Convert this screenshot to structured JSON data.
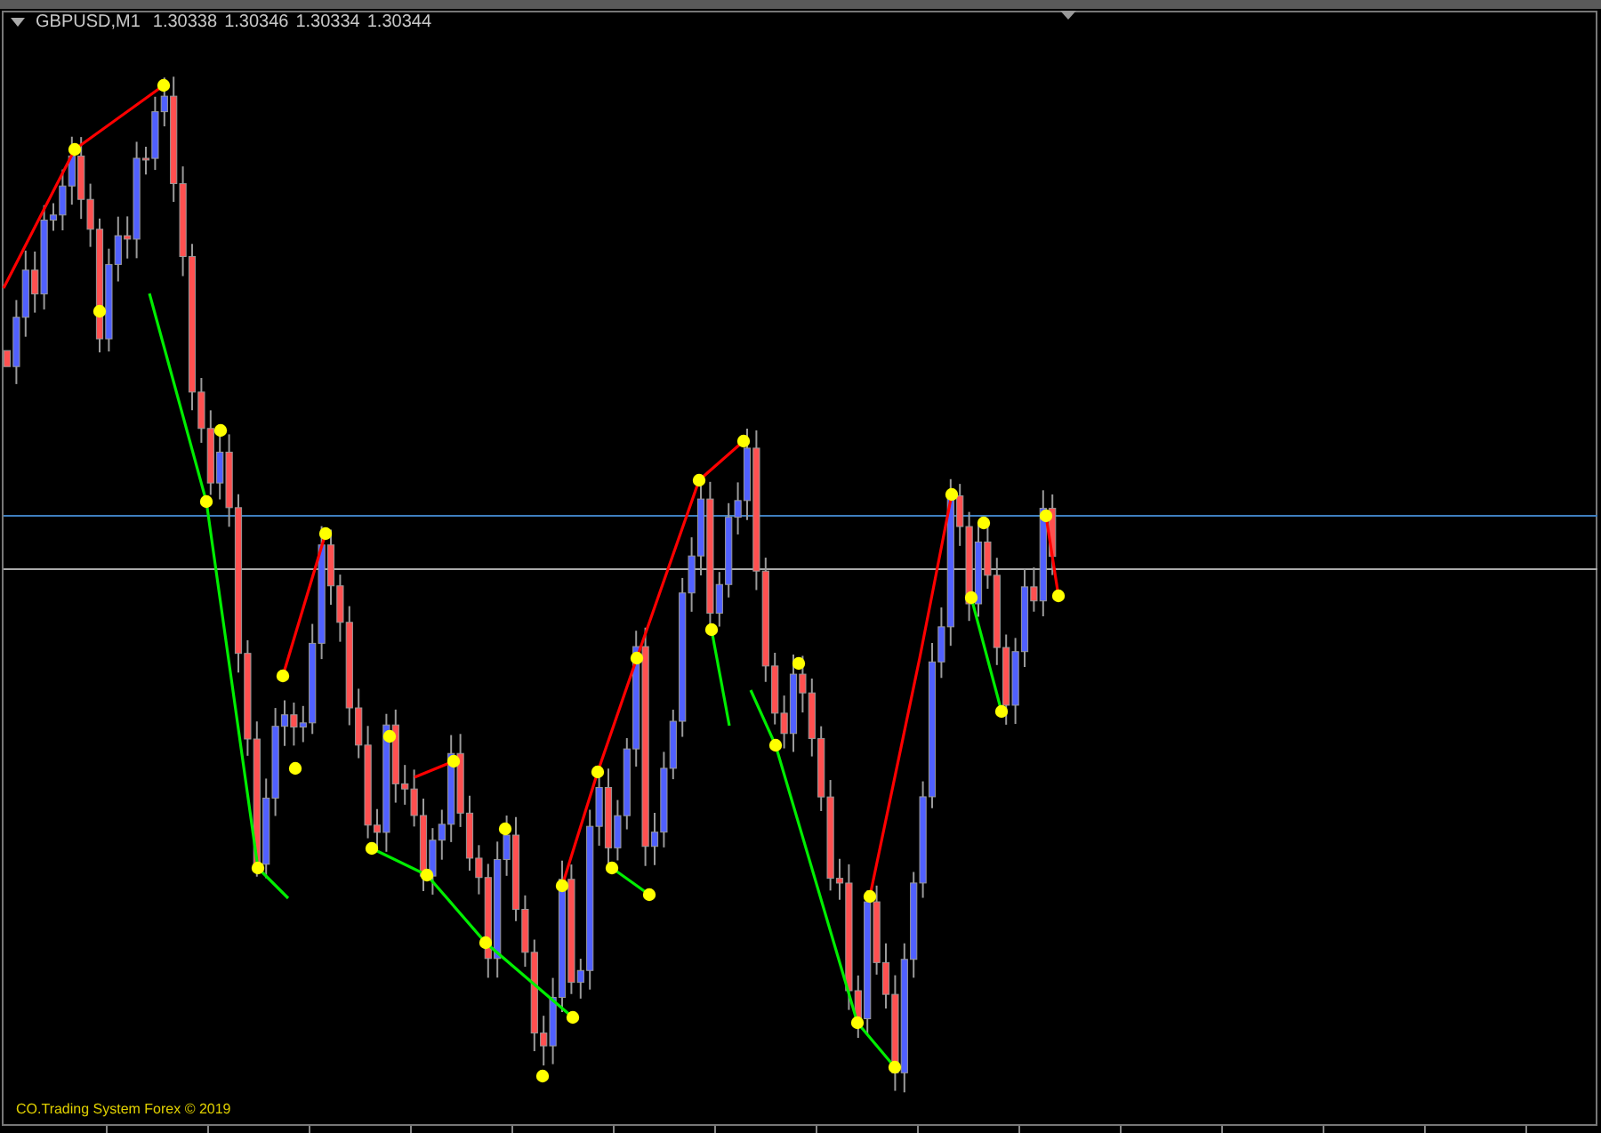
{
  "chart": {
    "symbol": "GBPUSD,M1",
    "quotes": [
      "1.30338",
      "1.30346",
      "1.30334",
      "1.30344"
    ],
    "footer": "CO.Trading System Forex © 2019"
  }
}
